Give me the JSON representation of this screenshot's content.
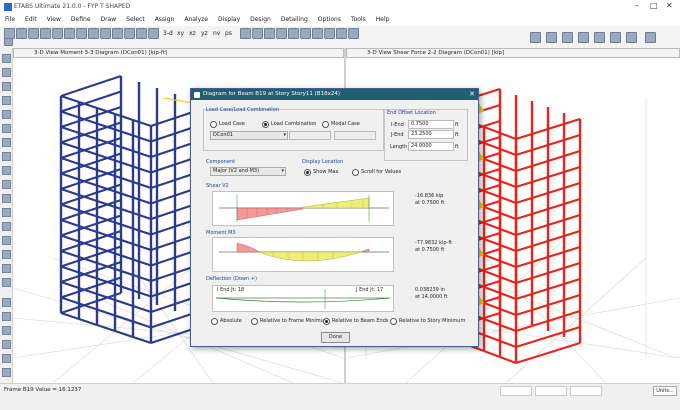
{
  "titlebar": {
    "title": "ETABS Ultimate 21.0.0 - FYP T SHAPED"
  },
  "menu": [
    "File",
    "Edit",
    "View",
    "Define",
    "Draw",
    "Select",
    "Assign",
    "Analyze",
    "Display",
    "Design",
    "Detailing",
    "Options",
    "Tools",
    "Help"
  ],
  "toolbar": {
    "view_3d": "3-d",
    "view_xy": "xy",
    "view_xz": "xz",
    "view_yz": "yz",
    "nv": "nv",
    "ps": "ps"
  },
  "left_panel": {
    "title": "3-D View   Moment 3-3 Diagram   (DCon01) [kip-ft]"
  },
  "right_panel": {
    "title": "3-D View   Shear Force 2-2 Diagram   (DCon01)  [kip]"
  },
  "status": {
    "text": "Frame B19   Value = 16.1237",
    "units": "Units..."
  },
  "dialog": {
    "title": "Diagram for Beam B19 at Story Story11 (B18x24)",
    "load_case_group": "Load Case/Load Combination",
    "radio_load_case": "Load Case",
    "radio_load_combination": "Load Combination",
    "radio_modal_case": "Modal Case",
    "combo_value": "DCon01",
    "end_offset": {
      "title": "End Offset Location",
      "i_end_label": "I-End",
      "i_end_value": "0.7500",
      "j_end_label": "J-End",
      "j_end_value": "23.2500",
      "length_label": "Length",
      "length_value": "24.0000",
      "unit": "ft"
    },
    "component_label": "Component",
    "component_value": "Major (V2 and M3)",
    "display_location_label": "Display Location",
    "show_max": "Show Max",
    "scroll_values": "Scroll for Values",
    "shear": {
      "title": "Shear V2",
      "value": "-16.836 kip",
      "at": "at 0.7500 ft"
    },
    "moment": {
      "title": "Moment M3",
      "value": "-77.9832 kip-ft",
      "at": "at 0.7500 ft"
    },
    "deflection": {
      "title": "Deflection (Down +)",
      "i_end": "I End Jt: 18",
      "j_end": "J End Jt: 17",
      "value": "0.038239 in",
      "at": "at 14.0000 ft"
    },
    "opt_absolute": "Absolute",
    "opt_rel_frame": "Relative to Frame Minimum",
    "opt_rel_beam": "Relative to Beam Ends",
    "opt_rel_story": "Relative to Story Minimum",
    "done": "Done"
  },
  "colors": {
    "frame_blue": "#2b3a8f",
    "frame_red": "#e8231b",
    "diagram_yellow": "#f2d21b",
    "dialog_title": "#1f5e73",
    "shear_pink": "#f29a9a",
    "moment_yellow": "#eeee77"
  }
}
